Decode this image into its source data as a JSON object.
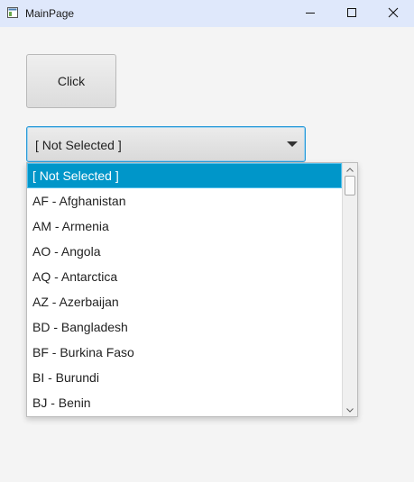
{
  "window": {
    "title": "MainPage"
  },
  "main": {
    "click_button_label": "Click",
    "combo": {
      "selected_value": "[ Not Selected ]",
      "options": [
        "[ Not Selected ]",
        "AF - Afghanistan",
        "AM - Armenia",
        "AO - Angola",
        "AQ - Antarctica",
        "AZ - Azerbaijan",
        "BD - Bangladesh",
        "BF - Burkina Faso",
        "BI - Burundi",
        "BJ - Benin"
      ],
      "highlighted_index": 0
    }
  },
  "colors": {
    "titlebar": "#dfe8fb",
    "selection": "#0096c9",
    "focus_border": "#2b9ad8",
    "background": "#f4f4f4"
  },
  "icons": {
    "app": "app-window-icon",
    "minimize": "minimize-icon",
    "maximize": "maximize-icon",
    "close": "close-icon",
    "dropdown": "chevron-down-icon",
    "scroll_up": "scroll-up-arrow-icon",
    "scroll_down": "scroll-down-arrow-icon"
  }
}
